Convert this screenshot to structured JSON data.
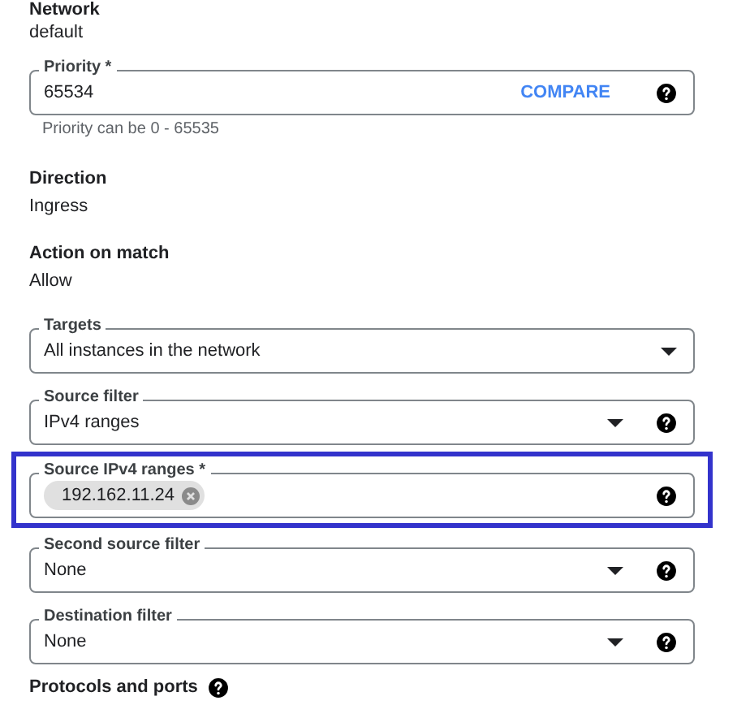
{
  "network": {
    "label": "Network",
    "value": "default"
  },
  "priority": {
    "label": "Priority *",
    "value": "65534",
    "action": "COMPARE",
    "help": true,
    "hint": "Priority can be 0 - 65535"
  },
  "direction": {
    "label": "Direction",
    "value": "Ingress"
  },
  "action_on_match": {
    "label": "Action on match",
    "value": "Allow"
  },
  "fields": [
    {
      "kind": "select",
      "label": "Targets",
      "value": "All instances in the network",
      "help": false,
      "highlighted": false
    },
    {
      "kind": "select",
      "label": "Source filter",
      "value": "IPv4 ranges",
      "help": true,
      "highlighted": false
    },
    {
      "kind": "chips",
      "label": "Source IPv4 ranges *",
      "chips": [
        "192.162.11.24"
      ],
      "help": true,
      "highlighted": true
    },
    {
      "kind": "select",
      "label": "Second source filter",
      "value": "None",
      "help": true,
      "highlighted": false
    },
    {
      "kind": "select",
      "label": "Destination filter",
      "value": "None",
      "help": true,
      "highlighted": false
    }
  ],
  "section_heading": {
    "label": "Protocols and ports",
    "help": true
  }
}
